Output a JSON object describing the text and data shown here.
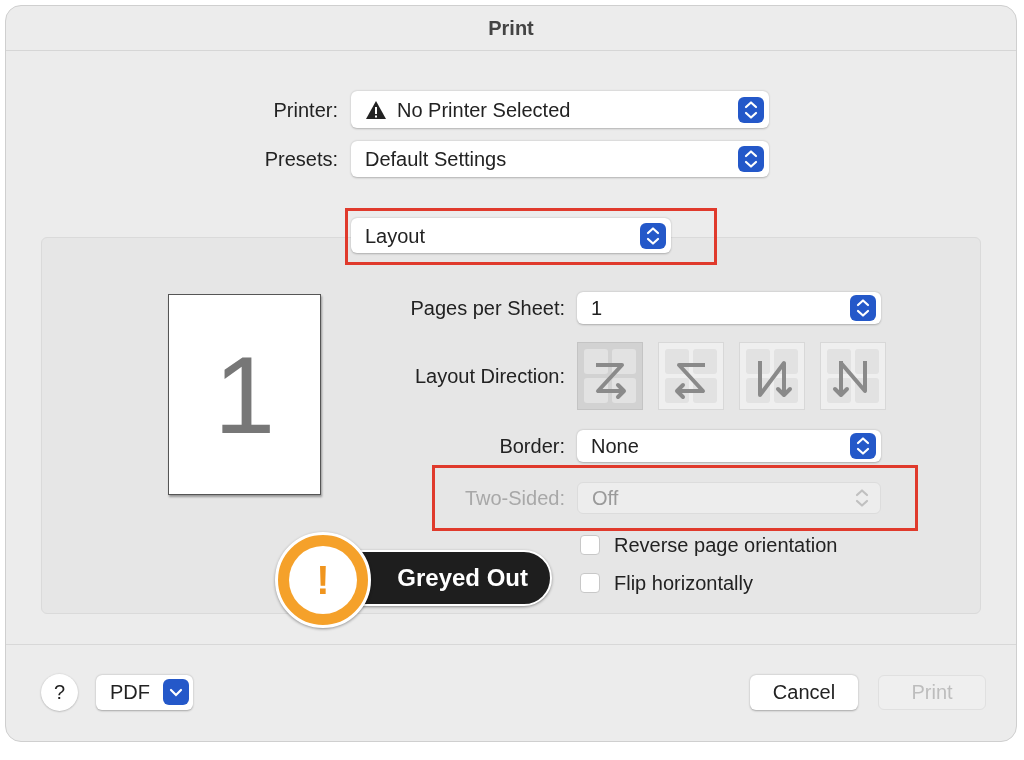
{
  "window": {
    "title": "Print"
  },
  "printer": {
    "label": "Printer:",
    "value": "No Printer Selected",
    "warning": true
  },
  "presets": {
    "label": "Presets:",
    "value": "Default Settings"
  },
  "section_menu": {
    "value": "Layout",
    "highlighted": true
  },
  "preview": {
    "page_number": "1"
  },
  "pages_per_sheet": {
    "label": "Pages per Sheet:",
    "value": "1"
  },
  "layout_direction": {
    "label": "Layout Direction:",
    "options": [
      {
        "kind": "z",
        "selected": true
      },
      {
        "kind": "reverse-z",
        "selected": false
      },
      {
        "kind": "reverse-n",
        "selected": false
      },
      {
        "kind": "n",
        "selected": false
      }
    ]
  },
  "border": {
    "label": "Border:",
    "value": "None"
  },
  "two_sided": {
    "label": "Two-Sided:",
    "value": "Off",
    "disabled": true,
    "highlighted": true
  },
  "checkboxes": [
    {
      "label": "Reverse page orientation",
      "checked": false
    },
    {
      "label": "Flip horizontally",
      "checked": false
    }
  ],
  "callout": {
    "icon": "!",
    "text": "Greyed Out"
  },
  "footer": {
    "help": "?",
    "pdf": "PDF",
    "cancel": "Cancel",
    "print": {
      "label": "Print",
      "disabled": true
    }
  }
}
